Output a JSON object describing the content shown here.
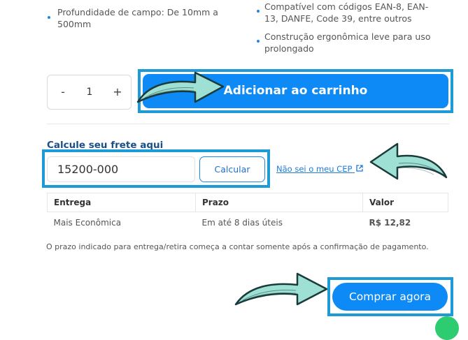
{
  "features": {
    "left": [
      "Profundidade de campo: De 10mm a",
      "500mm"
    ],
    "right_1": [
      "Compatível com códigos EAN-8, EAN-",
      "13, DANFE, Code 39, entre outros"
    ],
    "right_2": [
      "Construção ergonômica leve para uso",
      "prolongado"
    ]
  },
  "quantity": {
    "minus": "-",
    "value": "1",
    "plus": "+"
  },
  "add_to_cart_label": "Adicionar ao carrinho",
  "shipping": {
    "title": "Calcule seu frete aqui",
    "cep_value": "15200-000",
    "calculate_label": "Calcular",
    "unknown_cep_link": "Não sei o meu CEP",
    "table": {
      "headers": [
        "Entrega",
        "Prazo",
        "Valor"
      ],
      "rows": [
        {
          "entrega": "Mais Econômica",
          "prazo": "Em até 8 dias úteis",
          "valor": "R$ 12,82"
        }
      ]
    },
    "note": "O prazo indicado para entrega/retira começa a contar somente após a confirmação de pagamento."
  },
  "buy_now_label": "Comprar agora",
  "colors": {
    "primary": "#0d8af5",
    "highlight": "#1e9bd7",
    "arrow": "#9ee0d3"
  }
}
